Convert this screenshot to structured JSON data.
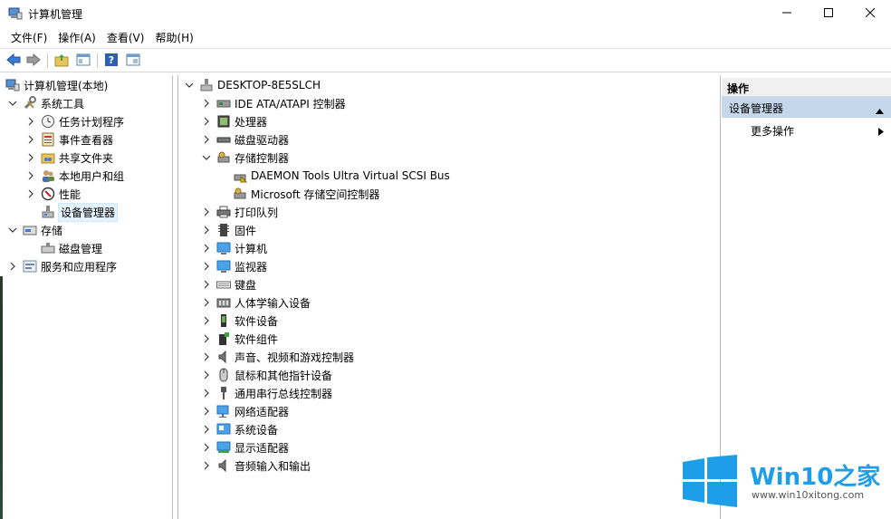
{
  "window": {
    "title": "计算机管理",
    "controls": {
      "minimize": "minimize-icon",
      "maximize": "maximize-icon",
      "close": "close-icon"
    }
  },
  "menubar": {
    "items": [
      {
        "label": "文件(F)"
      },
      {
        "label": "操作(A)"
      },
      {
        "label": "查看(V)"
      },
      {
        "label": "帮助(H)"
      }
    ]
  },
  "toolbar": {
    "icons": [
      "back-arrow-icon",
      "forward-arrow-icon",
      "folder-up-icon",
      "show-hide-tree-icon",
      "help-icon",
      "properties-icon"
    ]
  },
  "left_tree": {
    "root": {
      "label": "计算机管理(本地)",
      "icon": "computer-management-icon"
    },
    "system_tools": {
      "label": "系统工具",
      "icon": "tools-icon",
      "children": [
        {
          "label": "任务计划程序",
          "icon": "clock-icon"
        },
        {
          "label": "事件查看器",
          "icon": "event-viewer-icon"
        },
        {
          "label": "共享文件夹",
          "icon": "shared-folder-icon"
        },
        {
          "label": "本地用户和组",
          "icon": "users-icon"
        },
        {
          "label": "性能",
          "icon": "performance-icon"
        },
        {
          "label": "设备管理器",
          "icon": "device-manager-icon",
          "selected": true
        }
      ]
    },
    "storage": {
      "label": "存储",
      "icon": "storage-icon",
      "children": [
        {
          "label": "磁盘管理",
          "icon": "disk-management-icon"
        }
      ]
    },
    "services": {
      "label": "服务和应用程序",
      "icon": "services-icon"
    }
  },
  "device_tree": {
    "computer": {
      "label": "DESKTOP-8E5SLCH",
      "icon": "computer-icon"
    },
    "categories": [
      {
        "label": "IDE ATA/ATAPI 控制器",
        "icon": "ide-controller-icon",
        "expanded": false
      },
      {
        "label": "处理器",
        "icon": "processor-icon",
        "expanded": false
      },
      {
        "label": "磁盘驱动器",
        "icon": "disk-drive-icon",
        "expanded": false
      },
      {
        "label": "存储控制器",
        "icon": "storage-controller-icon",
        "expanded": true,
        "children": [
          {
            "label": "DAEMON Tools Ultra Virtual SCSI Bus",
            "icon": "scsi-icon"
          },
          {
            "label": "Microsoft 存储空间控制器",
            "icon": "scsi-icon"
          }
        ]
      },
      {
        "label": "打印队列",
        "icon": "printer-icon",
        "expanded": false
      },
      {
        "label": "固件",
        "icon": "firmware-icon",
        "expanded": false
      },
      {
        "label": "计算机",
        "icon": "monitor-icon",
        "expanded": false
      },
      {
        "label": "监视器",
        "icon": "monitor-icon",
        "expanded": false
      },
      {
        "label": "键盘",
        "icon": "keyboard-icon",
        "expanded": false
      },
      {
        "label": "人体学输入设备",
        "icon": "hid-icon",
        "expanded": false
      },
      {
        "label": "软件设备",
        "icon": "software-device-icon",
        "expanded": false
      },
      {
        "label": "软件组件",
        "icon": "software-component-icon",
        "expanded": false
      },
      {
        "label": "声音、视频和游戏控制器",
        "icon": "speaker-icon",
        "expanded": false
      },
      {
        "label": "鼠标和其他指针设备",
        "icon": "mouse-icon",
        "expanded": false
      },
      {
        "label": "通用串行总线控制器",
        "icon": "usb-icon",
        "expanded": false
      },
      {
        "label": "网络适配器",
        "icon": "network-icon",
        "expanded": false
      },
      {
        "label": "系统设备",
        "icon": "system-device-icon",
        "expanded": false
      },
      {
        "label": "显示适配器",
        "icon": "display-adapter-icon",
        "expanded": false
      },
      {
        "label": "音频输入和输出",
        "icon": "audio-io-icon",
        "expanded": false
      }
    ]
  },
  "actions": {
    "header": "操作",
    "section": "设备管理器",
    "more": "更多操作"
  },
  "watermark": {
    "brand": "Win10",
    "brand_cn": "之家",
    "url": "www.win10xitong.com"
  },
  "colors": {
    "selection": "#e5f3ff",
    "action_section": "#c5d7ea",
    "brand_blue": "#1e9ee8"
  }
}
